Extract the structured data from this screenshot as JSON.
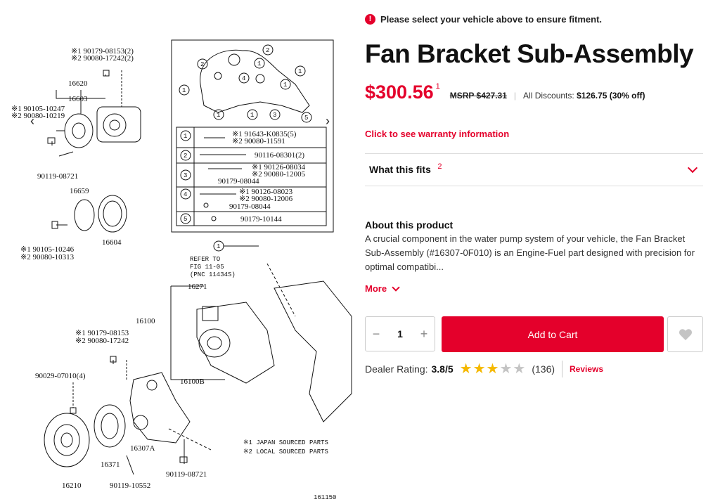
{
  "diagram": {
    "labels": {
      "l_90179_08153_2": "※1 90179-08153(2)",
      "l_90080_17242_2": "※2 90080-17242(2)",
      "l_16620": "16620",
      "l_16603": "16603",
      "l_90105_10247": "※1 90105-10247",
      "l_90080_10219": "※2 90080-10219",
      "l_90119_08721_a": "90119-08721",
      "l_16659": "16659",
      "l_16604": "16604",
      "l_90105_10246": "※1  90105-10246",
      "l_90080_10313": "※2  90080-10313",
      "l_16271": "16271",
      "l_16100": "16100",
      "l_90179_08153": "※1  90179-08153",
      "l_90080_17242": "※2  90080-17242",
      "l_90029_07010": "90029-07010(4)",
      "l_16100b": "16100B",
      "l_16307a": "16307A",
      "l_16371": "16371",
      "l_16210": "16210",
      "l_90119_10552": "90119-10552",
      "l_90119_08721_b": "90119-08721",
      "refer1": "REFER TO",
      "refer2": "FIG 11-05",
      "refer3": "(PNC 11434S)",
      "note1": "※1  JAPAN SOURCED PARTS",
      "note2": "※2  LOCAL SOURCED PARTS",
      "fig_no": "161150",
      "c1": "1",
      "c2": "2",
      "c3": "3",
      "c4": "4",
      "c5": "5"
    },
    "table": {
      "r1a": "※1 91643-K0835(5)",
      "r1b": "※2 90080-11591",
      "r2": "90116-08301(2)",
      "r3a": "※1 90126-08034",
      "r3b": "※2 90080-12005",
      "r3c": "90179-08044",
      "r4a": "※1  90126-08023",
      "r4b": "※2  90080-12006",
      "r4c": "90179-08044",
      "r5": "90179-10144"
    },
    "prev_icon": "chevron-left-icon",
    "next_icon": "chevron-right-icon",
    "prev_glyph": "‹",
    "next_glyph": "›"
  },
  "notice": {
    "icon": "alert-icon",
    "glyph": "!",
    "text": "Please select your vehicle above to ensure fitment."
  },
  "product": {
    "title": "Fan Bracket Sub-Assembly",
    "price": "$300.56",
    "price_footnote": "1",
    "msrp": "MSRP $427.31",
    "discounts_label": "All Discounts:",
    "discounts_value": "$126.75 (30% off)",
    "warranty_link": "Click to see warranty information",
    "fits_label": "What this fits",
    "fits_footnote": "2",
    "about_heading": "About this product",
    "about_text": "A crucial component in the water pump system of your vehicle, the Fan Bracket Sub-Assembly (#16307-0F010) is an Engine-Fuel part designed with precision for optimal compatibi...",
    "more_label": "More",
    "quantity": "1",
    "minus": "−",
    "plus": "+",
    "add_to_cart": "Add to Cart",
    "rating_label": "Dealer Rating:",
    "rating_value": "3.8/5",
    "rating_stars": 3,
    "rating_max": 5,
    "review_count": "(136)",
    "reviews_link": "Reviews"
  },
  "colors": {
    "accent": "#e4002b",
    "star": "#f5b800",
    "star_off": "#c4c4c4"
  }
}
